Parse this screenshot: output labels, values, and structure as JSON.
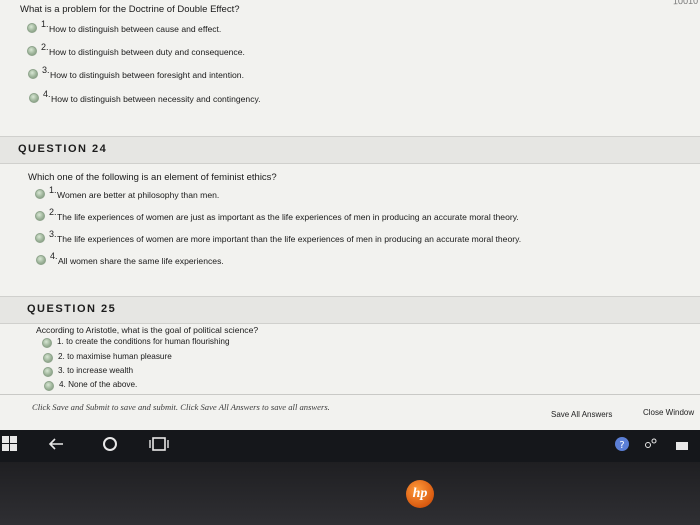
{
  "corner_text": "10010",
  "q23": {
    "text": "What is a problem for the Doctrine of Double Effect?",
    "options": [
      {
        "num": "1.",
        "label": "How to distinguish between cause and effect."
      },
      {
        "num": "2.",
        "label": "How to distinguish between duty and consequence."
      },
      {
        "num": "3.",
        "label": "How to distinguish between foresight and intention."
      },
      {
        "num": "4.",
        "label": "How to distinguish between necessity and contingency."
      }
    ]
  },
  "q24": {
    "header": "QUESTION 24",
    "text": "Which one of the following is an element of feminist ethics?",
    "options": [
      {
        "num": "1.",
        "label": "Women are better at philosophy than men."
      },
      {
        "num": "2.",
        "label": "The life experiences of women are just as important as the life experiences of men in producing an accurate moral theory."
      },
      {
        "num": "3.",
        "label": "The life experiences of women are more important than the life experiences of men in producing an accurate moral theory."
      },
      {
        "num": "4.",
        "label": "All women share the same life experiences."
      }
    ]
  },
  "q25": {
    "header": "QUESTION 25",
    "text": "According to Aristotle, what is the goal of political science?",
    "options": [
      {
        "label": "1. to create the conditions for human flourishing"
      },
      {
        "label": "2. to maximise human pleasure"
      },
      {
        "label": "3. to increase wealth"
      },
      {
        "label": "4. None of the above."
      }
    ]
  },
  "footer": {
    "instruction": "Click Save and Submit to save and submit. Click Save All Answers to save all answers.",
    "save_all": "Save All Answers",
    "close_window": "Close Window"
  },
  "taskbar": {
    "start_icon": "windows-icon",
    "back_icon": "back-arrow-icon",
    "search_icon": "circle-icon",
    "taskview_icon": "task-view-icon"
  },
  "bezel": {
    "brand": "hp"
  }
}
